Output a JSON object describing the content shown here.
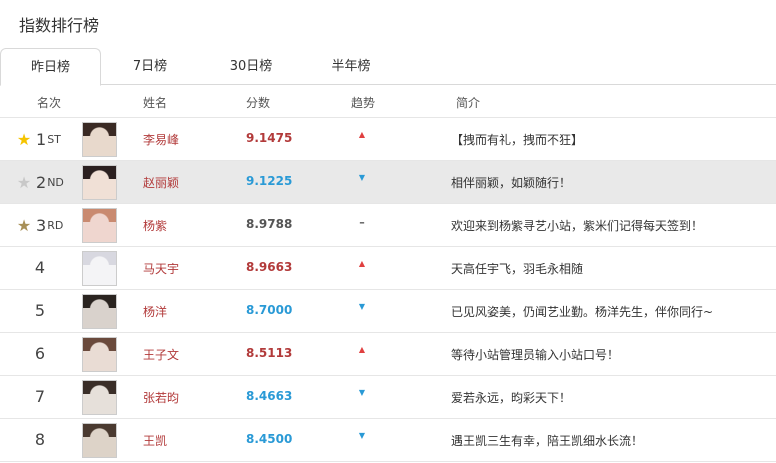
{
  "page": {
    "title": "指数排行榜"
  },
  "tabs": [
    {
      "label": "昨日榜",
      "active": true
    },
    {
      "label": "7日榜",
      "active": false
    },
    {
      "label": "30日榜",
      "active": false
    },
    {
      "label": "半年榜",
      "active": false
    }
  ],
  "columns": {
    "rank": "名次",
    "name": "姓名",
    "score": "分数",
    "trend": "趋势",
    "intro": "简介"
  },
  "colors": {
    "gold": "#f5c400",
    "silver": "#c8c8c8",
    "bronze": "#a89058",
    "score_red": "#b23a3a",
    "score_blue": "#2a9ad6",
    "score_gray": "#555555",
    "trend_up": "#e04040",
    "trend_down": "#2a9ad6",
    "trend_flat": "#555555"
  },
  "rows": [
    {
      "rank": "1",
      "suffix": "ST",
      "medal": "gold",
      "name": "李易峰",
      "score": "9.1475",
      "score_color": "red",
      "trend": "up",
      "intro": "【拽而有礼，拽而不狂】",
      "highlight": false
    },
    {
      "rank": "2",
      "suffix": "ND",
      "medal": "silver",
      "name": "赵丽颖",
      "score": "9.1225",
      "score_color": "blue",
      "trend": "down",
      "intro": "相伴丽颖，如颖随行！",
      "highlight": true
    },
    {
      "rank": "3",
      "suffix": "RD",
      "medal": "bronze",
      "name": "杨紫",
      "score": "8.9788",
      "score_color": "gray",
      "trend": "flat",
      "intro": "欢迎来到杨紫寻艺小站，紫米们记得每天签到！",
      "highlight": false
    },
    {
      "rank": "4",
      "suffix": "",
      "medal": "",
      "name": "马天宇",
      "score": "8.9663",
      "score_color": "red",
      "trend": "up",
      "intro": "天高任宇飞，羽毛永相随",
      "highlight": false
    },
    {
      "rank": "5",
      "suffix": "",
      "medal": "",
      "name": "杨洋",
      "score": "8.7000",
      "score_color": "blue",
      "trend": "down",
      "intro": "已见风姿美，仍闻艺业勤。杨洋先生，伴你同行~",
      "highlight": false
    },
    {
      "rank": "6",
      "suffix": "",
      "medal": "",
      "name": "王子文",
      "score": "8.5113",
      "score_color": "red",
      "trend": "up",
      "intro": "等待小站管理员输入小站口号！",
      "highlight": false
    },
    {
      "rank": "7",
      "suffix": "",
      "medal": "",
      "name": "张若昀",
      "score": "8.4663",
      "score_color": "blue",
      "trend": "down",
      "intro": "爱若永远，昀彩天下！",
      "highlight": false
    },
    {
      "rank": "8",
      "suffix": "",
      "medal": "",
      "name": "王凯",
      "score": "8.4500",
      "score_color": "blue",
      "trend": "down",
      "intro": "遇王凯三生有幸，陪王凯细水长流！",
      "highlight": false
    }
  ]
}
